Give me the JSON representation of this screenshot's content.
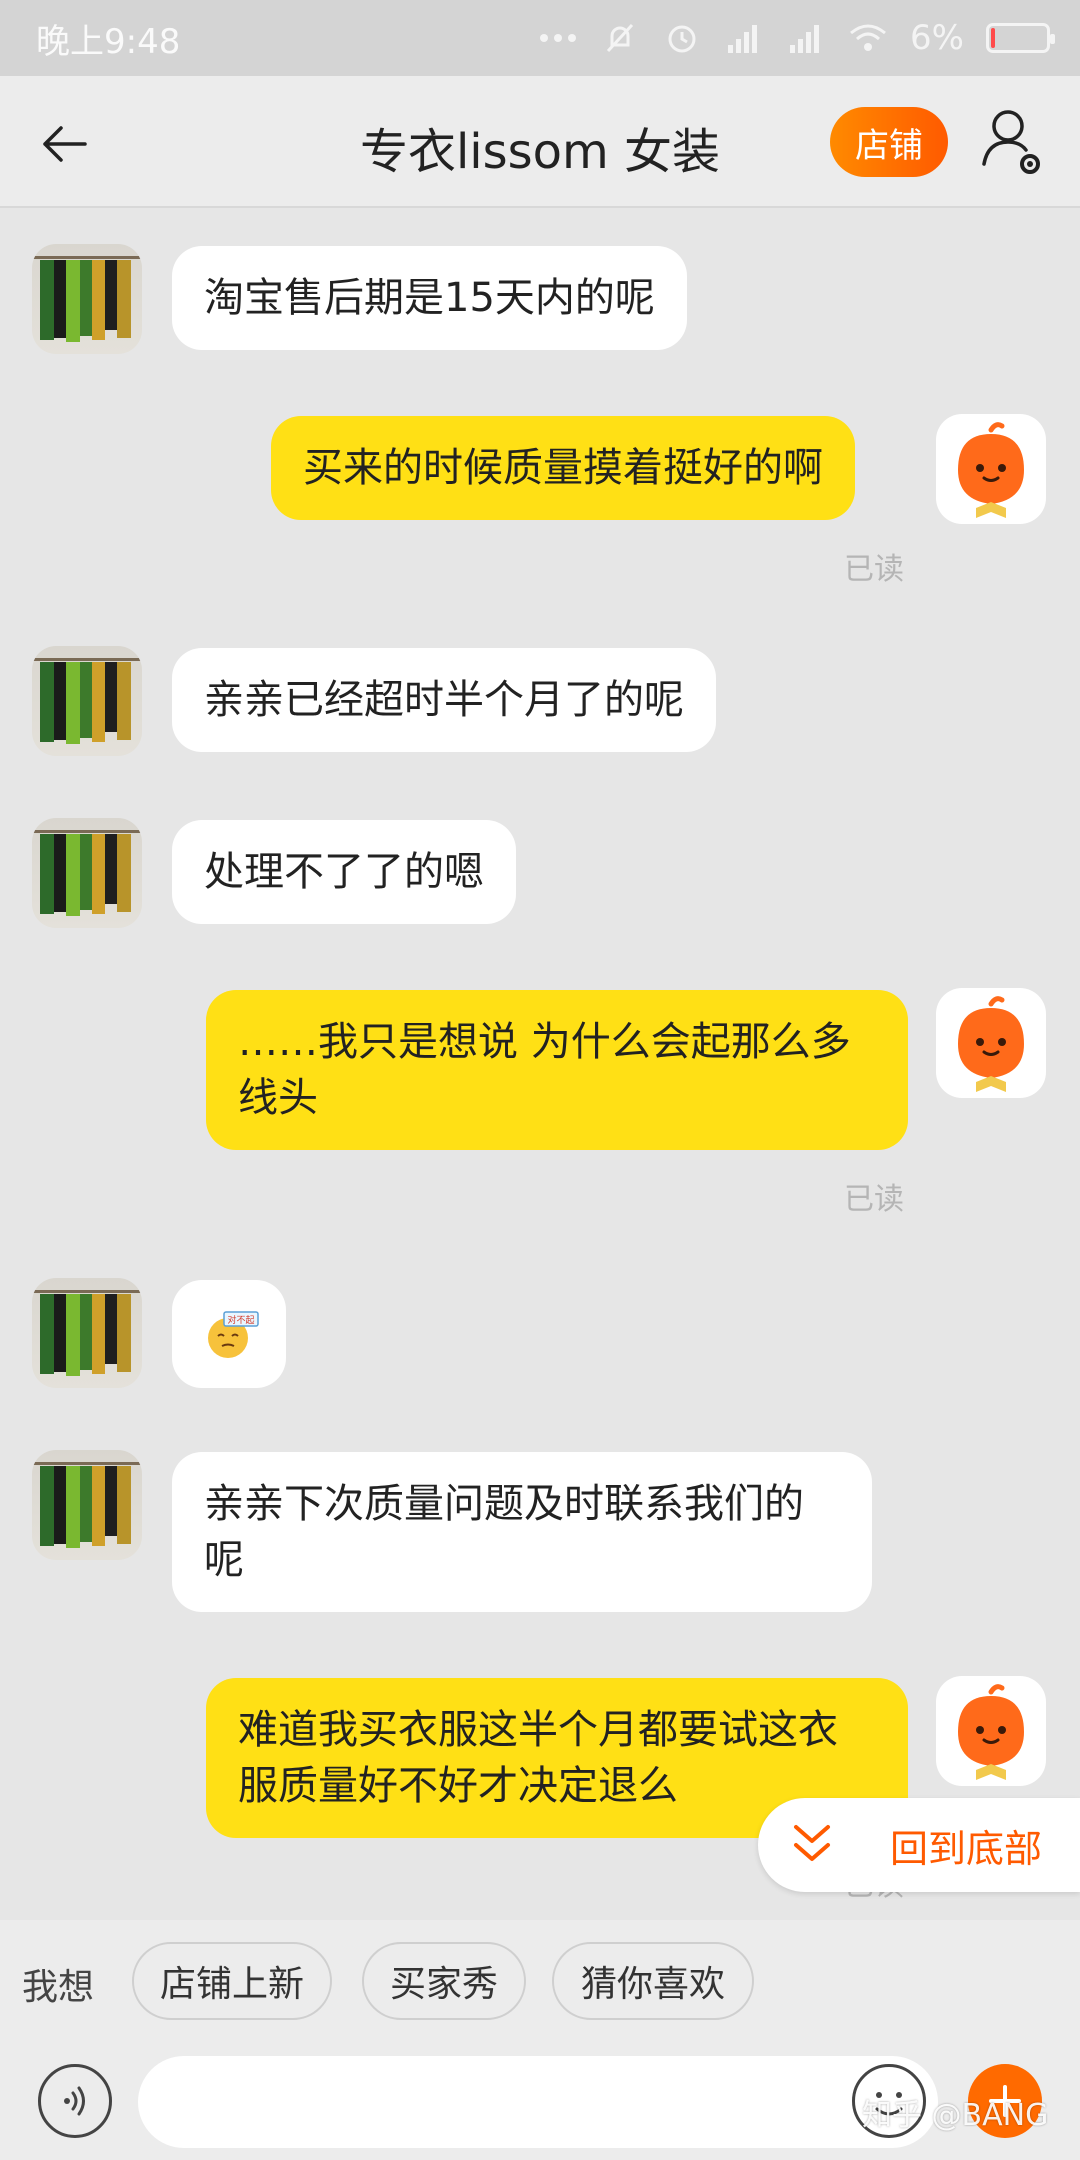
{
  "status_bar": {
    "time": "晚上9:48",
    "battery": "6%",
    "battery_level": 0.06,
    "icons": [
      "dots-icon",
      "bell-muted-icon",
      "alarm-icon",
      "signal-icon",
      "signal-icon",
      "wifi-icon",
      "battery-icon"
    ]
  },
  "header": {
    "title": "专衣lissom  女装",
    "shop_button": "店铺",
    "back_icon": "arrow-left-icon",
    "user_icon": "user-settings-icon"
  },
  "messages": [
    {
      "from": "shop",
      "text": "淘宝售后期是15天内的呢"
    },
    {
      "from": "me",
      "text": "买来的时候质量摸着挺好的啊",
      "status": "已读"
    },
    {
      "from": "shop",
      "text": "亲亲已经超时半个月了的呢"
    },
    {
      "from": "shop",
      "text": "处理不了了的嗯"
    },
    {
      "from": "me",
      "text": "……我只是想说 为什么会起那么多线头",
      "status": "已读"
    },
    {
      "from": "shop",
      "sticker": "对不起",
      "sticker_icon": "sorry-sticker-icon"
    },
    {
      "from": "shop",
      "text": "亲亲下次质量问题及时联系我们的呢"
    },
    {
      "from": "me",
      "text": "难道我买衣服这半个月都要试这衣服质量好不好才决定退么",
      "status": "已读"
    }
  ],
  "scroll_to_bottom": "回到底部",
  "quick_replies": {
    "prefix": "我想",
    "chips": [
      "店铺上新",
      "买家秀",
      "猜你喜欢"
    ]
  },
  "input": {
    "placeholder": "",
    "value": ""
  },
  "watermark": "知乎 @BANG",
  "colors": {
    "accent": "#ff6a00",
    "my_bubble": "#ffe015",
    "shop_bubble": "#ffffff",
    "background": "#e6e6e6"
  }
}
